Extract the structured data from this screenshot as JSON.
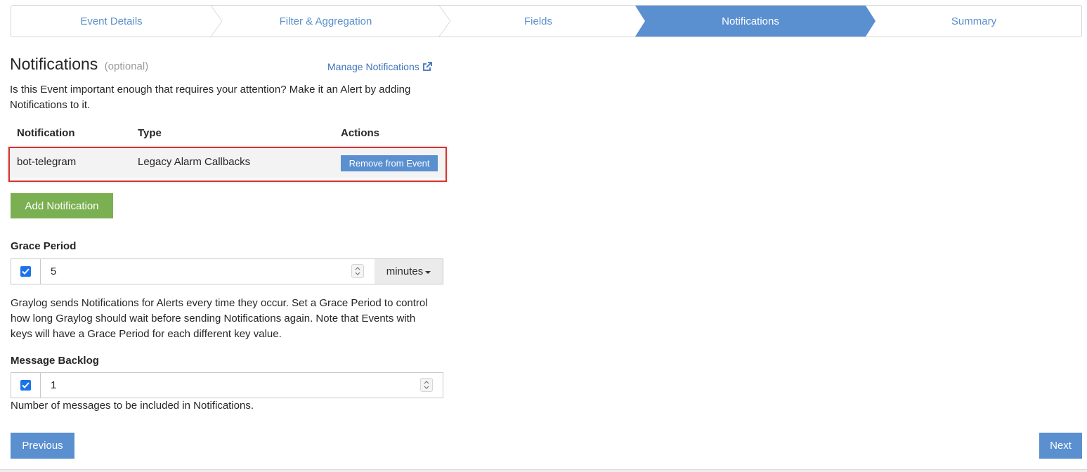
{
  "wizard": {
    "steps": [
      {
        "label": "Event Details",
        "active": false
      },
      {
        "label": "Filter & Aggregation",
        "active": false
      },
      {
        "label": "Fields",
        "active": false
      },
      {
        "label": "Notifications",
        "active": true
      },
      {
        "label": "Summary",
        "active": false
      }
    ]
  },
  "section": {
    "title": "Notifications",
    "optional": "(optional)",
    "manage_link": "Manage Notifications",
    "description": "Is this Event important enough that requires your attention? Make it an Alert by adding Notifications to it."
  },
  "table": {
    "headers": [
      "Notification",
      "Type",
      "Actions"
    ],
    "rows": [
      {
        "notification": "bot-telegram",
        "type": "Legacy Alarm Callbacks",
        "action": "Remove from Event"
      }
    ]
  },
  "add_button": "Add Notification",
  "grace_period": {
    "label": "Grace Period",
    "checked": true,
    "value": "5",
    "unit": "minutes",
    "help": "Graylog sends Notifications for Alerts every time they occur. Set a Grace Period to control how long Graylog should wait before sending Notifications again. Note that Events with keys will have a Grace Period for each different key value."
  },
  "message_backlog": {
    "label": "Message Backlog",
    "checked": true,
    "value": "1",
    "help": "Number of messages to be included in Notifications."
  },
  "nav": {
    "previous": "Previous",
    "next": "Next"
  },
  "colors": {
    "primary": "#5a8fd0",
    "success": "#7bb052",
    "highlight_border": "#d9312c",
    "checkbox": "#1a73e8"
  }
}
